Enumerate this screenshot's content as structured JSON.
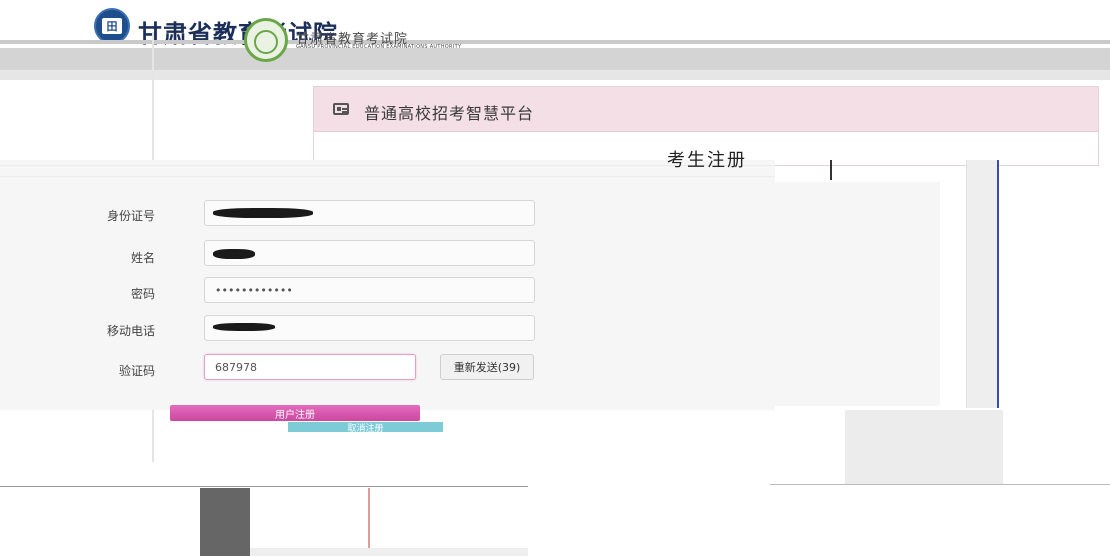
{
  "header": {
    "site_title": "甘肃省教育考试院",
    "logo2_text": "甘肃省教育考试院",
    "logo2_en": "GANSU PROVINCIAL EDUCATION EXAMINATIONS AUTHORITY"
  },
  "panel": {
    "title": "普通高校招考智慧平台",
    "register_heading": "考生注册"
  },
  "form": {
    "id_label": "身份证号",
    "name_label": "姓名",
    "password_label": "密码",
    "password_value": "••••••••••••",
    "phone_label": "移动电话",
    "captcha_label": "验证码",
    "captcha_value": "687978",
    "resend_label": "重新发送(39)"
  },
  "buttons": {
    "submit_label": "用户注册",
    "cancel_label": "取消注册"
  },
  "colors": {
    "panel_head": "#f3dfe5",
    "primary_button": "#d35aae",
    "secondary_button": "#7ecbd8"
  }
}
